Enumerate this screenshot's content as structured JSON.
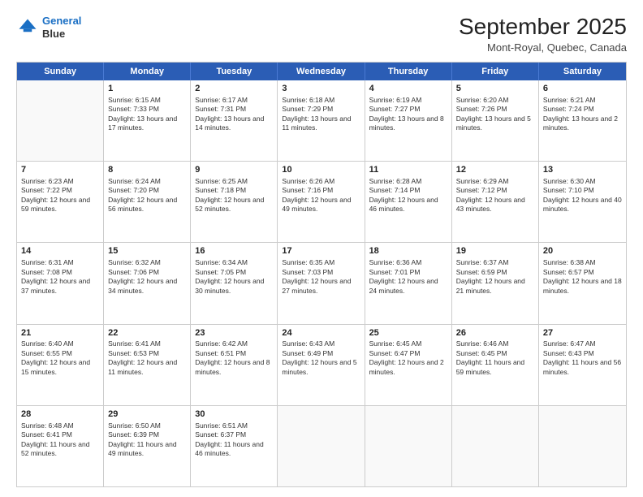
{
  "header": {
    "logo_line1": "General",
    "logo_line2": "Blue",
    "main_title": "September 2025",
    "subtitle": "Mont-Royal, Quebec, Canada"
  },
  "days_of_week": [
    "Sunday",
    "Monday",
    "Tuesday",
    "Wednesday",
    "Thursday",
    "Friday",
    "Saturday"
  ],
  "rows": [
    [
      {
        "day": "",
        "empty": true
      },
      {
        "day": "1",
        "sunrise": "Sunrise: 6:15 AM",
        "sunset": "Sunset: 7:33 PM",
        "daylight": "Daylight: 13 hours and 17 minutes."
      },
      {
        "day": "2",
        "sunrise": "Sunrise: 6:17 AM",
        "sunset": "Sunset: 7:31 PM",
        "daylight": "Daylight: 13 hours and 14 minutes."
      },
      {
        "day": "3",
        "sunrise": "Sunrise: 6:18 AM",
        "sunset": "Sunset: 7:29 PM",
        "daylight": "Daylight: 13 hours and 11 minutes."
      },
      {
        "day": "4",
        "sunrise": "Sunrise: 6:19 AM",
        "sunset": "Sunset: 7:27 PM",
        "daylight": "Daylight: 13 hours and 8 minutes."
      },
      {
        "day": "5",
        "sunrise": "Sunrise: 6:20 AM",
        "sunset": "Sunset: 7:26 PM",
        "daylight": "Daylight: 13 hours and 5 minutes."
      },
      {
        "day": "6",
        "sunrise": "Sunrise: 6:21 AM",
        "sunset": "Sunset: 7:24 PM",
        "daylight": "Daylight: 13 hours and 2 minutes."
      }
    ],
    [
      {
        "day": "7",
        "sunrise": "Sunrise: 6:23 AM",
        "sunset": "Sunset: 7:22 PM",
        "daylight": "Daylight: 12 hours and 59 minutes."
      },
      {
        "day": "8",
        "sunrise": "Sunrise: 6:24 AM",
        "sunset": "Sunset: 7:20 PM",
        "daylight": "Daylight: 12 hours and 56 minutes."
      },
      {
        "day": "9",
        "sunrise": "Sunrise: 6:25 AM",
        "sunset": "Sunset: 7:18 PM",
        "daylight": "Daylight: 12 hours and 52 minutes."
      },
      {
        "day": "10",
        "sunrise": "Sunrise: 6:26 AM",
        "sunset": "Sunset: 7:16 PM",
        "daylight": "Daylight: 12 hours and 49 minutes."
      },
      {
        "day": "11",
        "sunrise": "Sunrise: 6:28 AM",
        "sunset": "Sunset: 7:14 PM",
        "daylight": "Daylight: 12 hours and 46 minutes."
      },
      {
        "day": "12",
        "sunrise": "Sunrise: 6:29 AM",
        "sunset": "Sunset: 7:12 PM",
        "daylight": "Daylight: 12 hours and 43 minutes."
      },
      {
        "day": "13",
        "sunrise": "Sunrise: 6:30 AM",
        "sunset": "Sunset: 7:10 PM",
        "daylight": "Daylight: 12 hours and 40 minutes."
      }
    ],
    [
      {
        "day": "14",
        "sunrise": "Sunrise: 6:31 AM",
        "sunset": "Sunset: 7:08 PM",
        "daylight": "Daylight: 12 hours and 37 minutes."
      },
      {
        "day": "15",
        "sunrise": "Sunrise: 6:32 AM",
        "sunset": "Sunset: 7:06 PM",
        "daylight": "Daylight: 12 hours and 34 minutes."
      },
      {
        "day": "16",
        "sunrise": "Sunrise: 6:34 AM",
        "sunset": "Sunset: 7:05 PM",
        "daylight": "Daylight: 12 hours and 30 minutes."
      },
      {
        "day": "17",
        "sunrise": "Sunrise: 6:35 AM",
        "sunset": "Sunset: 7:03 PM",
        "daylight": "Daylight: 12 hours and 27 minutes."
      },
      {
        "day": "18",
        "sunrise": "Sunrise: 6:36 AM",
        "sunset": "Sunset: 7:01 PM",
        "daylight": "Daylight: 12 hours and 24 minutes."
      },
      {
        "day": "19",
        "sunrise": "Sunrise: 6:37 AM",
        "sunset": "Sunset: 6:59 PM",
        "daylight": "Daylight: 12 hours and 21 minutes."
      },
      {
        "day": "20",
        "sunrise": "Sunrise: 6:38 AM",
        "sunset": "Sunset: 6:57 PM",
        "daylight": "Daylight: 12 hours and 18 minutes."
      }
    ],
    [
      {
        "day": "21",
        "sunrise": "Sunrise: 6:40 AM",
        "sunset": "Sunset: 6:55 PM",
        "daylight": "Daylight: 12 hours and 15 minutes."
      },
      {
        "day": "22",
        "sunrise": "Sunrise: 6:41 AM",
        "sunset": "Sunset: 6:53 PM",
        "daylight": "Daylight: 12 hours and 11 minutes."
      },
      {
        "day": "23",
        "sunrise": "Sunrise: 6:42 AM",
        "sunset": "Sunset: 6:51 PM",
        "daylight": "Daylight: 12 hours and 8 minutes."
      },
      {
        "day": "24",
        "sunrise": "Sunrise: 6:43 AM",
        "sunset": "Sunset: 6:49 PM",
        "daylight": "Daylight: 12 hours and 5 minutes."
      },
      {
        "day": "25",
        "sunrise": "Sunrise: 6:45 AM",
        "sunset": "Sunset: 6:47 PM",
        "daylight": "Daylight: 12 hours and 2 minutes."
      },
      {
        "day": "26",
        "sunrise": "Sunrise: 6:46 AM",
        "sunset": "Sunset: 6:45 PM",
        "daylight": "Daylight: 11 hours and 59 minutes."
      },
      {
        "day": "27",
        "sunrise": "Sunrise: 6:47 AM",
        "sunset": "Sunset: 6:43 PM",
        "daylight": "Daylight: 11 hours and 56 minutes."
      }
    ],
    [
      {
        "day": "28",
        "sunrise": "Sunrise: 6:48 AM",
        "sunset": "Sunset: 6:41 PM",
        "daylight": "Daylight: 11 hours and 52 minutes."
      },
      {
        "day": "29",
        "sunrise": "Sunrise: 6:50 AM",
        "sunset": "Sunset: 6:39 PM",
        "daylight": "Daylight: 11 hours and 49 minutes."
      },
      {
        "day": "30",
        "sunrise": "Sunrise: 6:51 AM",
        "sunset": "Sunset: 6:37 PM",
        "daylight": "Daylight: 11 hours and 46 minutes."
      },
      {
        "day": "",
        "empty": true
      },
      {
        "day": "",
        "empty": true
      },
      {
        "day": "",
        "empty": true
      },
      {
        "day": "",
        "empty": true
      }
    ]
  ]
}
